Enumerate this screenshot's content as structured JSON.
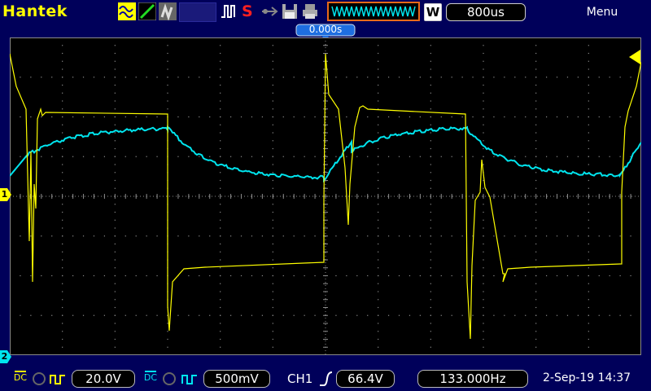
{
  "header": {
    "brand": "Hantek",
    "wave_mode_label": "W",
    "timebase": "800us",
    "trigger_offset": "0.000s",
    "menu_label": "Menu",
    "run_stop": "S"
  },
  "channels": {
    "ch1_marker": "1",
    "ch2_marker": "2",
    "ch1_coupling": "DC",
    "ch1_scale": "20.0V",
    "ch2_coupling": "DC",
    "ch2_scale": "500mV"
  },
  "trigger": {
    "source": "CH1",
    "level": "66.4V",
    "frequency": "133.000Hz"
  },
  "status": {
    "datetime": "2-Sep-19 14:37"
  },
  "colors": {
    "ch1": "#ffff00",
    "ch2": "#00e5ee",
    "grid": "#8a8a8a",
    "frame": "#00005a"
  }
}
